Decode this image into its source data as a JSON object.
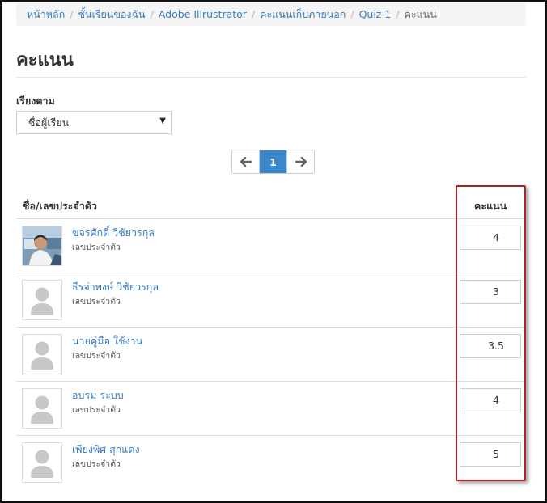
{
  "breadcrumb": [
    {
      "label": "หน้าหลัก",
      "link": true
    },
    {
      "label": "ชั้นเรียนของฉัน",
      "link": true
    },
    {
      "label": "Adobe Illrustrator",
      "link": true
    },
    {
      "label": "คะแนนเก็บภายนอก",
      "link": true
    },
    {
      "label": "Quiz 1",
      "link": true
    },
    {
      "label": "คะแนน",
      "link": false
    }
  ],
  "page_title": "คะแนน",
  "sort": {
    "label": "เรียงตาม",
    "selected": "ชื่อผู้เรียน"
  },
  "pagination": {
    "prev_icon": "arrow-left-icon",
    "current_page": "1",
    "next_icon": "arrow-right-icon"
  },
  "table": {
    "headers": {
      "name": "ชื่อ/เลขประจำตัว",
      "score": "คะแนน"
    },
    "rows": [
      {
        "name": "ขจรศักดิ์ วิชัยวรกุล",
        "id_label": "เลขประจำตัว",
        "score": "4",
        "avatar": "photo"
      },
      {
        "name": "ธีรจ่าพงษ์ วิชัยวรกุล",
        "id_label": "เลขประจำตัว",
        "score": "3",
        "avatar": "default"
      },
      {
        "name": "นายคู่มือ ใช้งาน",
        "id_label": "เลขประจำตัว",
        "score": "3.5",
        "avatar": "default"
      },
      {
        "name": "อบรม ระบบ",
        "id_label": "เลขประจำตัว",
        "score": "4",
        "avatar": "default"
      },
      {
        "name": "เพียงพิศ สุกแดง",
        "id_label": "เลขประจำตัว",
        "score": "5",
        "avatar": "default"
      }
    ]
  },
  "colors": {
    "link": "#3a7bbf",
    "active_page": "#3a87c9",
    "highlight": "#b22222"
  }
}
